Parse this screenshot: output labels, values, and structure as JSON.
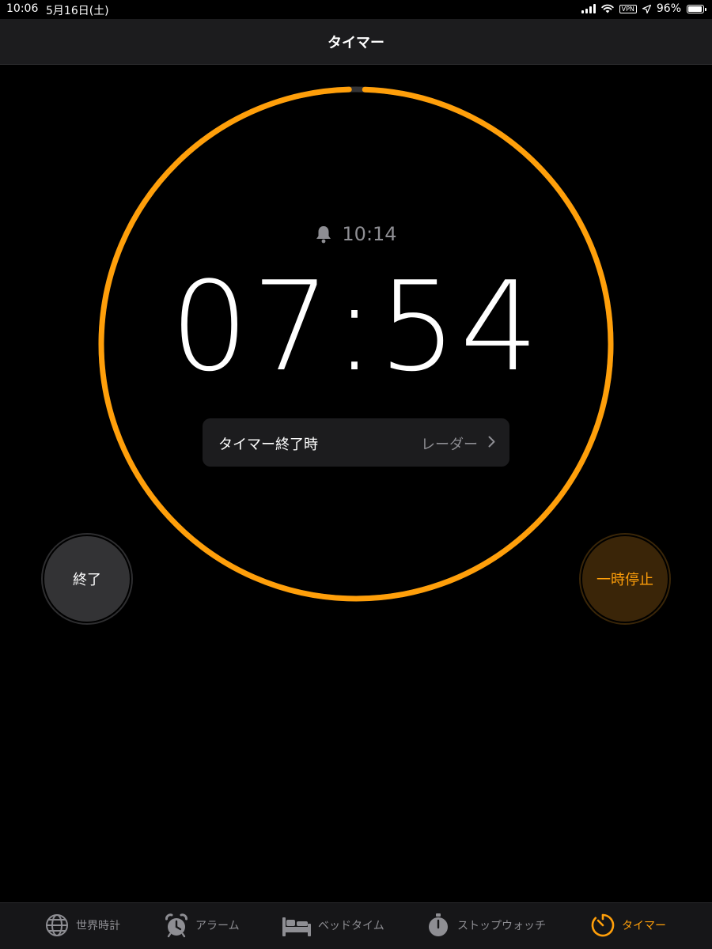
{
  "status_bar": {
    "time": "10:06",
    "date": "5月16日(土)",
    "vpn": "VPN",
    "battery": "96%",
    "battery_level": 0.96
  },
  "nav": {
    "title": "タイマー"
  },
  "timer": {
    "end_time": "10:14",
    "remaining": "07:54",
    "progress_remaining": 0.99,
    "sound_label": "タイマー終了時",
    "sound_value": "レーダー",
    "cancel_label": "終了",
    "pause_label": "一時停止"
  },
  "colors": {
    "accent": "#ff9f0a",
    "background": "#000000",
    "panel": "#1c1c1e",
    "secondary_text": "#8e8e93"
  },
  "tabs": [
    {
      "label": "世界時計",
      "icon": "globe-icon",
      "active": false
    },
    {
      "label": "アラーム",
      "icon": "alarm-clock-icon",
      "active": false
    },
    {
      "label": "ベッドタイム",
      "icon": "bed-icon",
      "active": false
    },
    {
      "label": "ストップウォッチ",
      "icon": "stopwatch-icon",
      "active": false
    },
    {
      "label": "タイマー",
      "icon": "timer-icon",
      "active": true
    }
  ]
}
